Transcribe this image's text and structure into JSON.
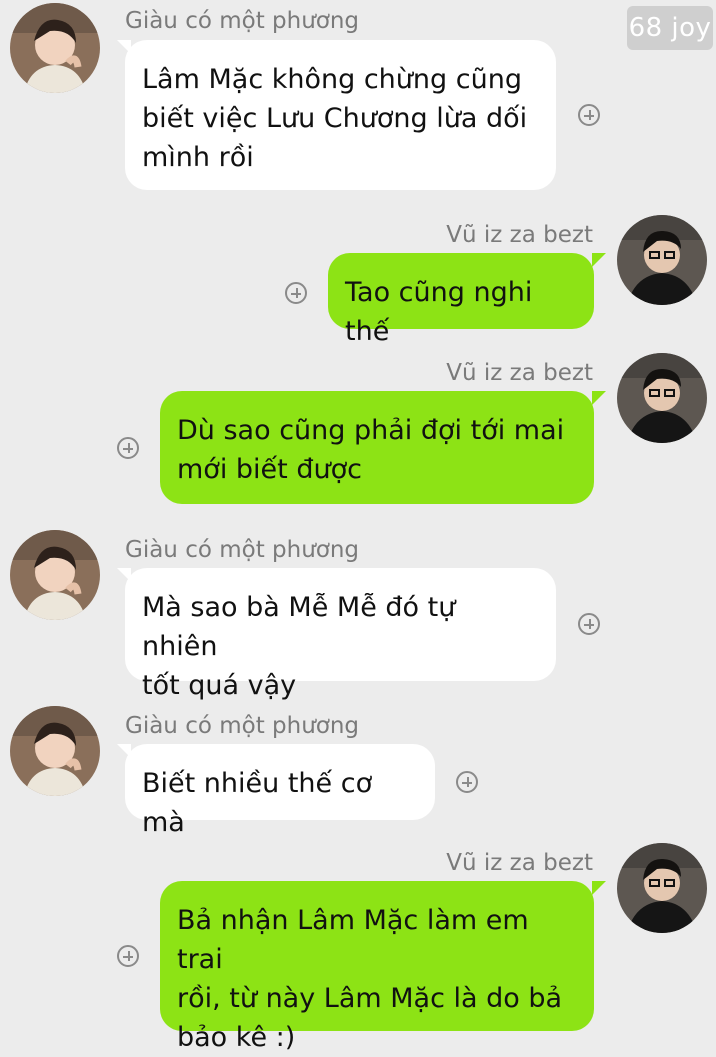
{
  "watermark": "68 joy",
  "contacts": {
    "left": {
      "name": "Giàu có một phương",
      "avatar_icon": "avatar-girl-icon"
    },
    "right": {
      "name": "Vũ iz za bezt",
      "avatar_icon": "avatar-boy-icon"
    }
  },
  "colors": {
    "background": "#ececec",
    "incoming_bubble": "#ffffff",
    "outgoing_bubble": "#8de315",
    "sender_name": "#7a7a7a"
  },
  "messages": [
    {
      "side": "left",
      "sender": "Giàu có một phương",
      "lines": [
        "Lâm Mặc không chừng cũng",
        "biết việc Lưu Chương lừa dối",
        "mình rồi"
      ]
    },
    {
      "side": "right",
      "sender": "Vũ iz za bezt",
      "lines": [
        "Tao cũng nghi thế"
      ]
    },
    {
      "side": "right",
      "sender": "Vũ iz za bezt",
      "lines": [
        "Dù sao cũng phải đợi tới mai",
        "mới biết được"
      ]
    },
    {
      "side": "left",
      "sender": "Giàu có một phương",
      "lines": [
        "Mà sao bà Mễ Mễ đó tự nhiên",
        "tốt quá vậy"
      ]
    },
    {
      "side": "left",
      "sender": "Giàu có một phương",
      "lines": [
        "Biết nhiều thế cơ mà"
      ]
    },
    {
      "side": "right",
      "sender": "Vũ iz za bezt",
      "lines": [
        "Bả nhận Lâm Mặc làm em trai",
        "rồi, từ này Lâm Mặc là do bả",
        "bảo kê :)"
      ]
    }
  ]
}
